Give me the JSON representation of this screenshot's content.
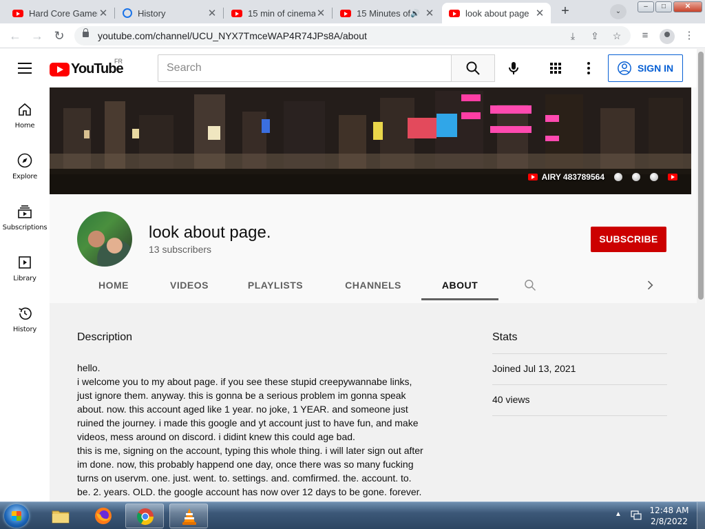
{
  "browser": {
    "tabs": [
      {
        "title": "Hard Core Gamer",
        "icon": "youtube-icon"
      },
      {
        "title": "History",
        "icon": "history-icon"
      },
      {
        "title": "15 min of cinema",
        "icon": "youtube-icon"
      },
      {
        "title": "15 Minutes of",
        "icon": "youtube-icon",
        "audio": true
      },
      {
        "title": "look about page",
        "icon": "youtube-icon",
        "active": true
      }
    ],
    "url": "youtube.com/channel/UCU_NYX7TmceWAP4R74JPs8A/about"
  },
  "youtube": {
    "logo_text": "YouTube",
    "country_code": "FR",
    "search_placeholder": "Search",
    "signin_label": "SIGN IN",
    "guide": [
      {
        "label": "Home",
        "icon": "home-icon"
      },
      {
        "label": "Explore",
        "icon": "compass-icon"
      },
      {
        "label": "Subscriptions",
        "icon": "subscriptions-icon"
      },
      {
        "label": "Library",
        "icon": "library-icon"
      },
      {
        "label": "History",
        "icon": "history-icon"
      }
    ]
  },
  "banner": {
    "link_label": "AIRY 483789564"
  },
  "channel": {
    "name": "look about page.",
    "subscribers": "13 subscribers",
    "subscribe_label": "SUBSCRIBE",
    "tabs": [
      "HOME",
      "VIDEOS",
      "PLAYLISTS",
      "CHANNELS",
      "ABOUT"
    ],
    "active_tab": "ABOUT"
  },
  "about": {
    "description_title": "Description",
    "description_lines": [
      "hello.",
      "i welcome you to my about page. if you see these stupid creepywannabe links,",
      "just ignore them. anyway. this is gonna be a serious problem im gonna speak",
      "about. now. this account aged like 1 year. no joke, 1 YEAR. and someone just",
      "ruined the journey. i made this google and yt account just to have fun, and make",
      "videos, mess around on discord. i didint knew this could age bad.",
      "this is me, signing on the account, typing this whole thing. i will later sign out after",
      "im done. now, this probably happend one day, once there was so many fucking",
      "turns on uservm. one. just. went. to. settings. and. comfirmed. the. account. to.",
      "be. 2. years. OLD. the google account has now over 12 days to be gone. forever."
    ],
    "stats_title": "Stats",
    "joined": "Joined Jul 13, 2021",
    "views": "40 views"
  },
  "taskbar": {
    "time": "12:48 AM",
    "date": "2/8/2022"
  },
  "colors": {
    "youtube_red": "#ff0000",
    "subscribe_red": "#cc0000",
    "signin_blue": "#065fd4",
    "about_bg": "#f1f1f1"
  }
}
